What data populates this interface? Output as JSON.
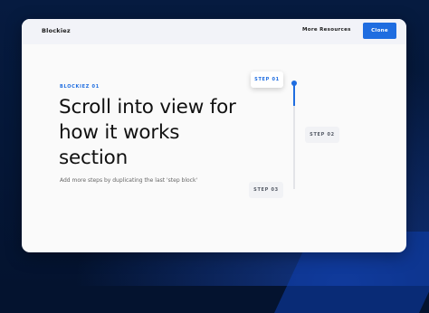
{
  "nav": {
    "brand": "Blockiez",
    "link_label": "More Resources",
    "button_label": "Clone"
  },
  "hero": {
    "eyebrow": "BLOCKIEZ 01",
    "headline": "Scroll into view for how it works section",
    "subtext": "Add more steps by duplicating the last 'step block'"
  },
  "steps": [
    {
      "label": "STEP 01",
      "active": true
    },
    {
      "label": "STEP 02",
      "active": false
    },
    {
      "label": "STEP 03",
      "active": false
    }
  ],
  "progress": 0.22,
  "colors": {
    "accent": "#1f6de0",
    "background": "#04132f",
    "card": "#fafafa"
  }
}
